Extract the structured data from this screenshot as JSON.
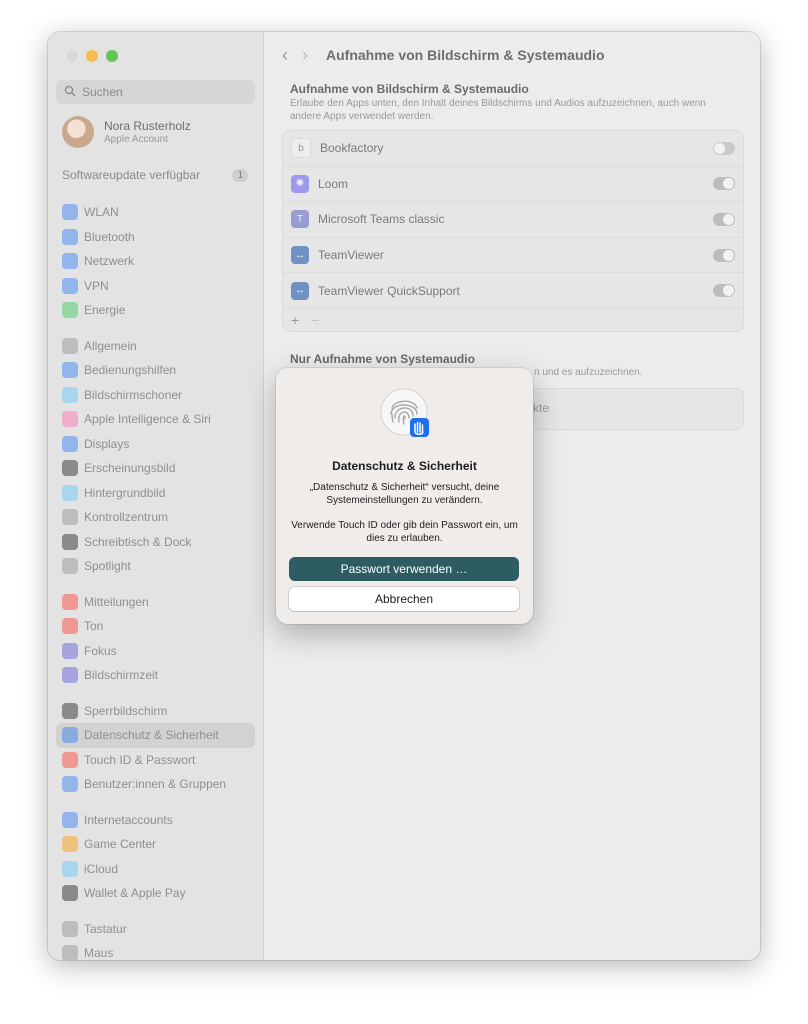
{
  "window_title": "Aufnahme von Bildschirm & Systemaudio",
  "sidebar": {
    "search_placeholder": "Suchen",
    "account": {
      "name": "Nora Rusterholz",
      "subtitle": "Apple Account"
    },
    "update": {
      "label": "Softwareupdate verfügbar",
      "badge": "1"
    },
    "groups": [
      [
        {
          "label": "WLAN",
          "color": "#2f7cf6"
        },
        {
          "label": "Bluetooth",
          "color": "#2f7cf6"
        },
        {
          "label": "Netzwerk",
          "color": "#2f7cf6"
        },
        {
          "label": "VPN",
          "color": "#2f7cf6"
        },
        {
          "label": "Energie",
          "color": "#34c759"
        }
      ],
      [
        {
          "label": "Allgemein",
          "color": "#8e8e93"
        },
        {
          "label": "Bedienungshilfen",
          "color": "#2f7cf6"
        },
        {
          "label": "Bildschirmschoner",
          "color": "#5ac8fa"
        },
        {
          "label": "Apple Intelligence & Siri",
          "color": "#ff6ab0"
        },
        {
          "label": "Displays",
          "color": "#2f7cf6"
        },
        {
          "label": "Erscheinungsbild",
          "color": "#1d1d1f"
        },
        {
          "label": "Hintergrundbild",
          "color": "#5ac8fa"
        },
        {
          "label": "Kontrollzentrum",
          "color": "#8e8e93"
        },
        {
          "label": "Schreibtisch & Dock",
          "color": "#1d1d1f"
        },
        {
          "label": "Spotlight",
          "color": "#8e8e93"
        }
      ],
      [
        {
          "label": "Mitteilungen",
          "color": "#ff3b30"
        },
        {
          "label": "Ton",
          "color": "#ff3b30"
        },
        {
          "label": "Fokus",
          "color": "#5856d6"
        },
        {
          "label": "Bildschirmzeit",
          "color": "#5856d6"
        }
      ],
      [
        {
          "label": "Sperrbildschirm",
          "color": "#1d1d1f"
        },
        {
          "label": "Datenschutz & Sicherheit",
          "color": "#2f7cf6",
          "active": true
        },
        {
          "label": "Touch ID & Passwort",
          "color": "#ff3b30"
        },
        {
          "label": "Benutzer:innen & Gruppen",
          "color": "#2f7cf6"
        }
      ],
      [
        {
          "label": "Internetaccounts",
          "color": "#2f7cf6"
        },
        {
          "label": "Game Center",
          "color": "#ff9500"
        },
        {
          "label": "iCloud",
          "color": "#5ac8fa"
        },
        {
          "label": "Wallet & Apple Pay",
          "color": "#1d1d1f"
        }
      ],
      [
        {
          "label": "Tastatur",
          "color": "#8e8e93"
        },
        {
          "label": "Maus",
          "color": "#8e8e93"
        }
      ]
    ]
  },
  "main": {
    "section_title": "Aufnahme von Bildschirm & Systemaudio",
    "section_description": "Erlaube den Apps unten, den Inhalt deines Bildschirms und Audios aufzuzeichnen, auch wenn andere Apps verwendet werden.",
    "apps": [
      {
        "name": "Bookfactory",
        "on": false,
        "icon": "bookfactory-icon",
        "color": "#f5f5f5",
        "glyph": "b"
      },
      {
        "name": "Loom",
        "on": true,
        "icon": "loom-icon",
        "color": "#625df5",
        "glyph": "✺"
      },
      {
        "name": "Microsoft Teams classic",
        "on": true,
        "icon": "teams-icon",
        "color": "#5b5fc7",
        "glyph": "T"
      },
      {
        "name": "TeamViewer",
        "on": true,
        "icon": "teamviewer-icon",
        "color": "#0e4fa6",
        "glyph": "↔"
      },
      {
        "name": "TeamViewer QuickSupport",
        "on": true,
        "icon": "teamviewer-qs-icon",
        "color": "#0e4fa6",
        "glyph": "↔"
      }
    ],
    "add_symbol": "+",
    "remove_symbol": "−",
    "section2_title": "Nur Aufnahme von Systemaudio",
    "section2_description_tail": "n und es aufzuzeichnen.",
    "section2_panel_tail": "kte"
  },
  "dialog": {
    "title": "Datenschutz & Sicherheit",
    "message": "„Datenschutz & Sicherheit“ versucht, deine Systemeinstellungen zu verändern.",
    "message2": "Verwende Touch ID oder gib dein Passwort ein, um dies zu erlauben.",
    "primary_button": "Passwort verwenden …",
    "secondary_button": "Abbrechen"
  }
}
